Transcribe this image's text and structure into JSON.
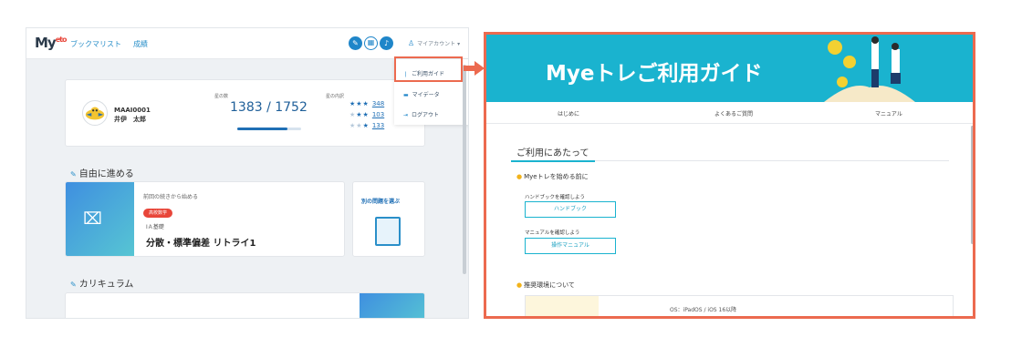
{
  "app": {
    "logo": "My",
    "logo_sup": "eto",
    "nav": [
      "ブックマリスト",
      "成績"
    ],
    "account_label": "マイアカウント",
    "dropdown": [
      {
        "icon": "guide-icon",
        "label": "ご利用ガイド"
      },
      {
        "icon": "data-icon",
        "label": "マイデータ"
      },
      {
        "icon": "logout-icon",
        "label": "ログアウト"
      }
    ],
    "profile": {
      "user_id": "MAAI0001",
      "user_name": "井伊　太郎",
      "stars_label": "星の数",
      "stars_count": "1383 / 1752",
      "stars_progress": 0.79,
      "breakdown_label": "星の内訳",
      "breakdown": [
        {
          "stars": "★★★",
          "filled": 3,
          "count": "348"
        },
        {
          "stars": "★★★",
          "filled": 2,
          "count": "103"
        },
        {
          "stars": "★★★",
          "filled": 1,
          "count": "133"
        }
      ]
    },
    "free_section_title": "自由に進める",
    "free_card": {
      "continue_text": "前回の続きから始める",
      "tag": "高校数学",
      "course": "ⅠＡ基礎",
      "lesson": "分散・標準偏差 リトライ1"
    },
    "other_label": "別の問題を選ぶ",
    "curriculum_title": "カリキュラム"
  },
  "guide": {
    "title": "Myeトレご利用ガイド",
    "tabs": [
      "はじめに",
      "よくあるご質問",
      "マニュアル"
    ],
    "section": "ご利用にあたって",
    "before_start": "Myeトレを始める前に",
    "handbook_hint": "ハンドブックを確認しよう",
    "handbook_btn": "ハンドブック",
    "manual_hint": "マニュアルを確認しよう",
    "manual_btn": "操作マニュアル",
    "env_title": "推奨環境について",
    "env_os": "OS：iPadOS / iOS 16以降"
  },
  "colors": {
    "accent": "#1ab3cf",
    "highlight": "#ec6a4f",
    "brand": "#1f86c9"
  }
}
